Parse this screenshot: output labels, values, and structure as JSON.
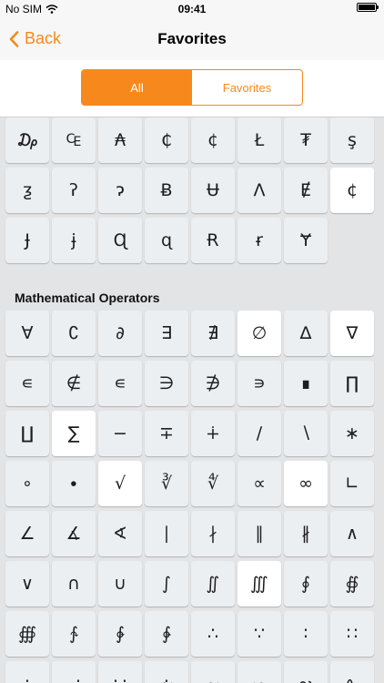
{
  "status_bar": {
    "carrier": "No SIM",
    "time": "09:41"
  },
  "nav": {
    "back_label": "Back",
    "title": "Favorites"
  },
  "segments": [
    {
      "label": "All",
      "active": true
    },
    {
      "label": "Favorites",
      "active": false
    }
  ],
  "currency_keys": [
    {
      "symbol": "₯",
      "fav": false
    },
    {
      "symbol": "₠",
      "fav": false
    },
    {
      "symbol": "₳",
      "fav": false
    },
    {
      "symbol": "₵",
      "fav": false
    },
    {
      "symbol": "¢",
      "fav": false
    },
    {
      "symbol": "Ł",
      "fav": false
    },
    {
      "symbol": "₮",
      "fav": false
    },
    {
      "symbol": "ş",
      "fav": false
    },
    {
      "symbol": "ƺ",
      "fav": false
    },
    {
      "symbol": "ʔ",
      "fav": false
    },
    {
      "symbol": "ɂ",
      "fav": false
    },
    {
      "symbol": "Ƀ",
      "fav": false
    },
    {
      "symbol": "Ʉ",
      "fav": false
    },
    {
      "symbol": "Λ",
      "fav": false
    },
    {
      "symbol": "Ɇ",
      "fav": false
    },
    {
      "symbol": "¢",
      "fav": true
    },
    {
      "symbol": "Ɉ",
      "fav": false
    },
    {
      "symbol": "ɉ",
      "fav": false
    },
    {
      "symbol": "Ɋ",
      "fav": false
    },
    {
      "symbol": "ɋ",
      "fav": false
    },
    {
      "symbol": "Ɍ",
      "fav": false
    },
    {
      "symbol": "ɍ",
      "fav": false
    },
    {
      "symbol": "Ɏ",
      "fav": false
    }
  ],
  "section_title": "Mathematical Operators",
  "math_keys": [
    {
      "symbol": "∀",
      "fav": false
    },
    {
      "symbol": "∁",
      "fav": false
    },
    {
      "symbol": "∂",
      "fav": false
    },
    {
      "symbol": "∃",
      "fav": false
    },
    {
      "symbol": "∄",
      "fav": false
    },
    {
      "symbol": "∅",
      "fav": true
    },
    {
      "symbol": "∆",
      "fav": false
    },
    {
      "symbol": "∇",
      "fav": true
    },
    {
      "symbol": "∊",
      "fav": false
    },
    {
      "symbol": "∉",
      "fav": false
    },
    {
      "symbol": "∊",
      "fav": false
    },
    {
      "symbol": "∋",
      "fav": false
    },
    {
      "symbol": "∌",
      "fav": false
    },
    {
      "symbol": "∍",
      "fav": false
    },
    {
      "symbol": "∎",
      "fav": false
    },
    {
      "symbol": "∏",
      "fav": false
    },
    {
      "symbol": "∐",
      "fav": false
    },
    {
      "symbol": "∑",
      "fav": true
    },
    {
      "symbol": "−",
      "fav": false
    },
    {
      "symbol": "∓",
      "fav": false
    },
    {
      "symbol": "∔",
      "fav": false
    },
    {
      "symbol": "∕",
      "fav": false
    },
    {
      "symbol": "∖",
      "fav": false
    },
    {
      "symbol": "∗",
      "fav": false
    },
    {
      "symbol": "∘",
      "fav": false
    },
    {
      "symbol": "∙",
      "fav": false
    },
    {
      "symbol": "√",
      "fav": true
    },
    {
      "symbol": "∛",
      "fav": false
    },
    {
      "symbol": "∜",
      "fav": false
    },
    {
      "symbol": "∝",
      "fav": false
    },
    {
      "symbol": "∞",
      "fav": true
    },
    {
      "symbol": "∟",
      "fav": false
    },
    {
      "symbol": "∠",
      "fav": false
    },
    {
      "symbol": "∡",
      "fav": false
    },
    {
      "symbol": "∢",
      "fav": false
    },
    {
      "symbol": "∣",
      "fav": false
    },
    {
      "symbol": "∤",
      "fav": false
    },
    {
      "symbol": "∥",
      "fav": false
    },
    {
      "symbol": "∦",
      "fav": false
    },
    {
      "symbol": "∧",
      "fav": false
    },
    {
      "symbol": "∨",
      "fav": false
    },
    {
      "symbol": "∩",
      "fav": false
    },
    {
      "symbol": "∪",
      "fav": false
    },
    {
      "symbol": "∫",
      "fav": false
    },
    {
      "symbol": "∬",
      "fav": false
    },
    {
      "symbol": "∭",
      "fav": true
    },
    {
      "symbol": "∮",
      "fav": false
    },
    {
      "symbol": "∯",
      "fav": false
    },
    {
      "symbol": "∰",
      "fav": false
    },
    {
      "symbol": "∱",
      "fav": false
    },
    {
      "symbol": "∲",
      "fav": false
    },
    {
      "symbol": "∳",
      "fav": false
    },
    {
      "symbol": "∴",
      "fav": false
    },
    {
      "symbol": "∵",
      "fav": false
    },
    {
      "symbol": "∶",
      "fav": false
    },
    {
      "symbol": "∷",
      "fav": false
    },
    {
      "symbol": "∸",
      "fav": false
    },
    {
      "symbol": "∹",
      "fav": false
    },
    {
      "symbol": "∺",
      "fav": false
    },
    {
      "symbol": "∻",
      "fav": false
    },
    {
      "symbol": "∼",
      "fav": false
    },
    {
      "symbol": "∽",
      "fav": false
    },
    {
      "symbol": "∾",
      "fav": false
    },
    {
      "symbol": "∿",
      "fav": false
    }
  ]
}
